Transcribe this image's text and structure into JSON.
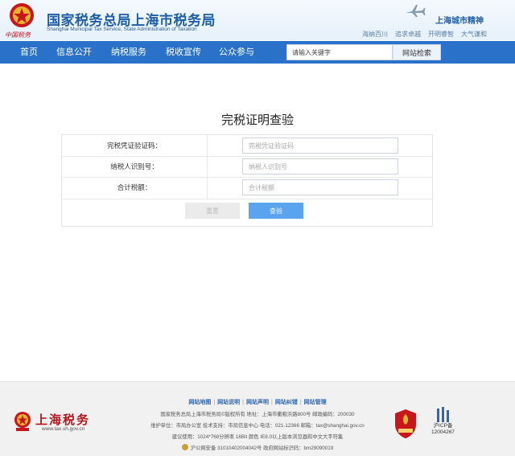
{
  "header": {
    "emblem_text": "中国税务",
    "title": "国家税务总局上海市税务局",
    "subtitle": "Shanghai Municipal Tax Service, State Administration of Taxation",
    "city_spirit": "上海城市精神",
    "spirit_words": [
      "海纳百川",
      "追求卓越",
      "开明睿智",
      "大气谦和"
    ]
  },
  "nav": {
    "items": [
      "首页",
      "信息公开",
      "纳税服务",
      "税收宣传",
      "公众参与"
    ],
    "search_placeholder": "请输入关键字",
    "search_button": "网站检索"
  },
  "main": {
    "title": "完税证明查验",
    "fields": [
      {
        "label": "完税凭证验证码：",
        "placeholder": "完税凭证验证码"
      },
      {
        "label": "纳税人识别号：",
        "placeholder": "纳税人识别号"
      },
      {
        "label": "合计税额：",
        "placeholder": "合计税额"
      }
    ],
    "reset_button": "重置",
    "query_button": "查验"
  },
  "footer": {
    "links": [
      "网站地图",
      "网站说明",
      "网站声明",
      "网站纠错",
      "网站管理"
    ],
    "lines": [
      "国家税务总局上海市税务局©版权所有 地址：上海市衢粮浜路800号 邮政编码：200030",
      "维护单位：市局办公室 技术支持：市局信息中心 电话：021-12366 邮箱：tax@shanghai.gov.cn",
      "建议使用：1024*768分辨率 16Bit 颜色 IE8.0以上版本浏览器和中文大字符集",
      "沪公网安备 31010402004042号   政府网站标识码：bm29090019"
    ],
    "logo_name": "上海税务",
    "logo_url": "www.tax.sh.gov.cn",
    "icp_label": "沪ICP备",
    "icp_number": "12004267"
  },
  "colors": {
    "nav_blue": "#2a72c9",
    "title_blue": "#1e5fa8",
    "brand_red": "#c8161d",
    "query_button": "#5aa3ee"
  }
}
